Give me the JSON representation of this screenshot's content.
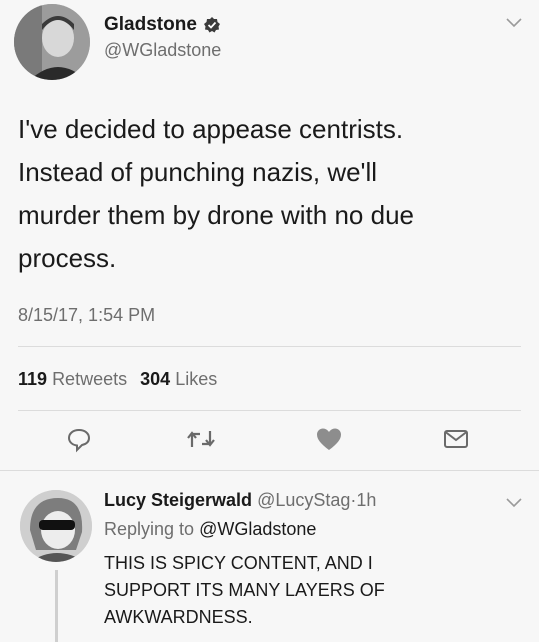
{
  "tweet": {
    "display_name": "Gladstone",
    "handle": "@WGladstone",
    "verified_icon": "verified-badge-icon",
    "text_lines": [
      "I've decided to appease centrists.",
      "Instead of punching nazis, we'll",
      "murder them by drone with no due",
      "process."
    ],
    "timestamp": "8/15/17, 1:54 PM",
    "retweet_count": "119",
    "retweet_label": "Retweets",
    "like_count": "304",
    "like_label": "Likes",
    "actions": [
      "reply-icon",
      "retweet-icon",
      "like-icon",
      "message-icon"
    ]
  },
  "reply": {
    "display_name": "Lucy Steigerwald",
    "handle": "@LucyStag",
    "separator": "·",
    "time": "1h",
    "replying_prefix": "Replying to",
    "replying_to": "@WGladstone",
    "text_lines": [
      "THIS IS SPICY CONTENT, AND I",
      "SUPPORT ITS MANY LAYERS OF",
      "AWKWARDNESS."
    ]
  },
  "colors": {
    "background": "#f7f7f7",
    "text": "#1a1a1a",
    "muted": "#6e6e6e",
    "divider": "#dcdcdc"
  }
}
